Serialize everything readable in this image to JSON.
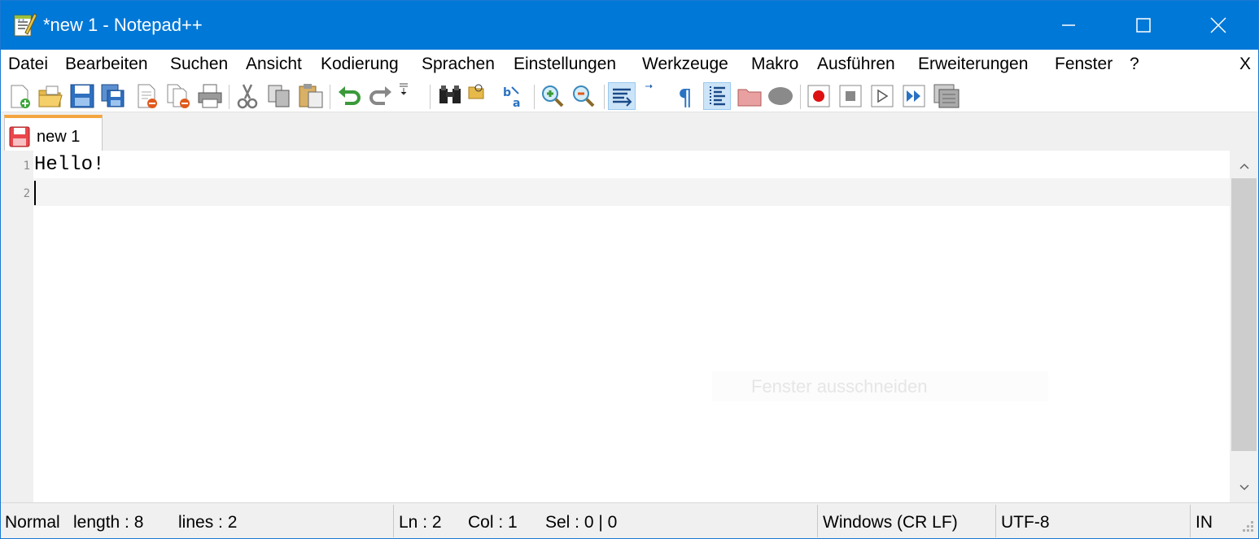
{
  "window": {
    "title": "*new 1 - Notepad++",
    "controls": {
      "minimize": "minimize-icon",
      "maximize": "maximize-icon",
      "close": "close-icon"
    }
  },
  "menubar": {
    "items": [
      "Datei",
      "Bearbeiten",
      "Suchen",
      "Ansicht",
      "Kodierung",
      "Sprachen",
      "Einstellungen",
      "Werkzeuge",
      "Makro",
      "Ausführen",
      "Erweiterungen",
      "Fenster",
      "?"
    ],
    "close_doc": "X"
  },
  "toolbar": {
    "buttons": [
      "new-file-icon",
      "open-file-icon",
      "save-icon",
      "save-all-icon",
      "close-icon",
      "close-all-icon",
      "print-icon",
      "cut-icon",
      "copy-icon",
      "paste-icon",
      "undo-icon",
      "redo-icon",
      "find-icon",
      "replace-icon",
      "zoom-in-icon",
      "zoom-out-icon",
      "sync-vertical-icon",
      "word-wrap-icon",
      "show-all-chars-icon",
      "indent-guide-icon",
      "folder-as-workspace-icon",
      "function-list-icon",
      "macro-record-icon",
      "macro-stop-icon",
      "macro-play-icon",
      "macro-run-multiple-icon",
      "macro-save-icon"
    ]
  },
  "tabs": [
    {
      "label": "new 1",
      "modified": true,
      "active": true
    }
  ],
  "editor": {
    "lines": [
      {
        "number": "1",
        "text": "Hello!"
      },
      {
        "number": "2",
        "text": ""
      }
    ],
    "current_line": 2
  },
  "overlay": {
    "text": "Fenster ausschneiden"
  },
  "statusbar": {
    "doc_type": "Normal",
    "length": "length : 8",
    "lines": "lines : 2",
    "ln": "Ln : 2",
    "col": "Col : 1",
    "sel": "Sel : 0 | 0",
    "eol": "Windows (CR LF)",
    "encoding": "UTF-8",
    "mode": "IN"
  },
  "colors": {
    "titlebar": "#0078d7",
    "tab_accent": "#f5a540",
    "current_line": "#f4f4f4",
    "gutter": "#f0f0f0"
  }
}
